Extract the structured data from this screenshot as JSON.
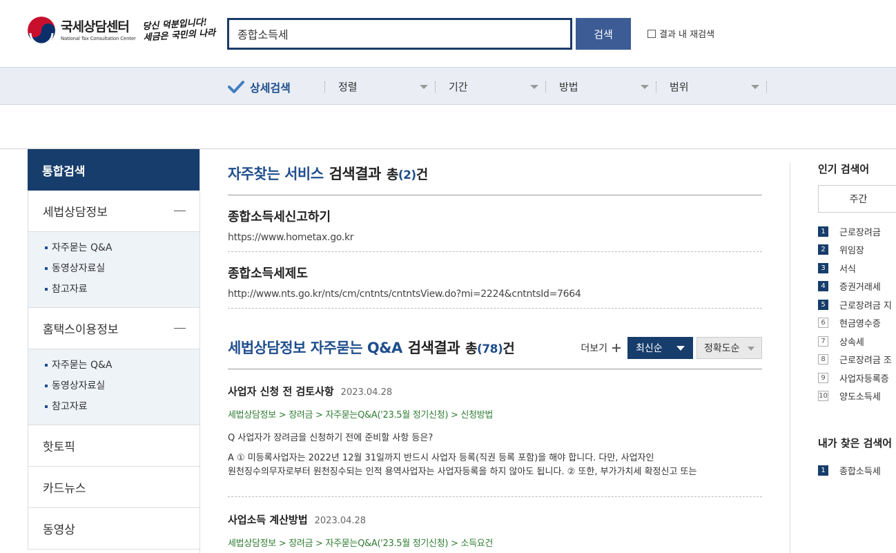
{
  "header": {
    "logo_kr": "국세상담센터",
    "logo_en": "National Tax Consultation Center",
    "slogan_line1": "당신 덕분입니다!",
    "slogan_line2": "세금은 국민의 나라",
    "search_value": "종합소득세",
    "search_button": "검색",
    "research_label": "결과 내 재검색"
  },
  "filters": {
    "detail_label": "상세검색",
    "dropdowns": [
      "정렬",
      "기간",
      "방법",
      "범위"
    ]
  },
  "sidebar": {
    "head": "통합검색",
    "sections": [
      {
        "label": "세법상담정보",
        "items": [
          "자주묻는 Q&A",
          "동영상자료실",
          "참고자료"
        ]
      },
      {
        "label": "홈택스이용정보",
        "items": [
          "자주묻는 Q&A",
          "동영상자료실",
          "참고자료"
        ]
      }
    ],
    "links": [
      "핫토픽",
      "카드뉴스",
      "동영상"
    ]
  },
  "services": {
    "title_blue": "자주찾는 서비스",
    "title_rest": "검색결과",
    "count_label_pre": "총",
    "count": "(2)",
    "count_label_post": "건",
    "items": [
      {
        "title": "종합소득세신고하기",
        "url": "https://www.hometax.go.kr"
      },
      {
        "title": "종합소득세제도",
        "url": "http://www.nts.go.kr/nts/cm/cntnts/cntntsView.do?mi=2224&cntntsId=7664"
      }
    ]
  },
  "qa": {
    "title_blue": "세법상담정보 자주묻는 Q&A",
    "title_rest": "검색결과",
    "count_label_pre": "총",
    "count": "(78)",
    "count_label_post": "건",
    "more_label": "더보기",
    "sort_new": "최신순",
    "sort_accuracy": "정확도순",
    "items": [
      {
        "title": "사업자 신청 전 검토사항",
        "date": "2023.04.28",
        "crumb": "세법상담정보 > 장려금 > 자주묻는Q&A('23.5월 정기신청) > 신청방법",
        "question": "Q 사업자가 장려금을 신청하기 전에 준비할 사항 등은?",
        "answer_line1": "A ① 미등록사업자는 2022년 12월 31일까지 반드시 사업자 등록(직권 등록 포함)을 해야 합니다. 다만, 사업자인",
        "answer_line2": "원천징수의무자로부터 원천징수되는 인적 용역사업자는 사업자등록을 하지 않아도 됩니다. ② 또한, 부가가치세 확정신고 또는"
      },
      {
        "title": "사업소득 계산방법",
        "date": "2023.04.28",
        "crumb": "세법상담정보 > 장려금 > 자주묻는Q&A('23.5월 정기신청) > 소득요건"
      }
    ]
  },
  "popular": {
    "title": "인기 검색어",
    "tab": "주간",
    "items": [
      {
        "rank": "1",
        "term": "근로장려금"
      },
      {
        "rank": "2",
        "term": "위임장"
      },
      {
        "rank": "3",
        "term": "서식"
      },
      {
        "rank": "4",
        "term": "증권거래세"
      },
      {
        "rank": "5",
        "term": "근로장려금 지"
      },
      {
        "rank": "6",
        "term": "현금영수증"
      },
      {
        "rank": "7",
        "term": "상속세"
      },
      {
        "rank": "8",
        "term": "근로장려금 조"
      },
      {
        "rank": "9",
        "term": "사업자등록증"
      },
      {
        "rank": "10",
        "term": "양도소득세"
      }
    ]
  },
  "my_searches": {
    "title": "내가 찾은 검색어",
    "items": [
      {
        "rank": "1",
        "term": "종합소득세"
      }
    ]
  },
  "colors": {
    "navy": "#163d6b",
    "accent_blue": "#1f4e8c",
    "button_blue": "#3d5c95",
    "crumb_green": "#2e7d32"
  }
}
